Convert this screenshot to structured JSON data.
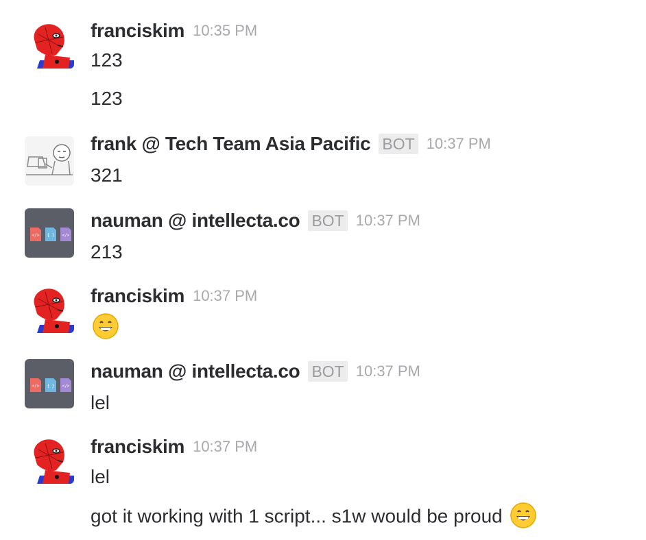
{
  "messages": [
    {
      "sender": "franciskim",
      "time": "10:35 PM",
      "lines": [
        "123",
        "123"
      ]
    },
    {
      "sender": "frank @ Tech Team Asia Pacific",
      "badge": "BOT",
      "time": "10:37 PM",
      "lines": [
        "321"
      ]
    },
    {
      "sender": "nauman @ intellecta.co",
      "badge": "BOT",
      "time": "10:37 PM",
      "lines": [
        "213"
      ]
    },
    {
      "sender": "franciskim",
      "time": "10:37 PM",
      "emoji": "grinning-face"
    },
    {
      "sender": "nauman @ intellecta.co",
      "badge": "BOT",
      "time": "10:37 PM",
      "lines": [
        "lel"
      ]
    },
    {
      "sender": "franciskim",
      "time": "10:37 PM",
      "lines": [
        "lel",
        "got it working with 1 script... s1w would be proud"
      ],
      "trailing_emoji": "grinning-face"
    }
  ],
  "colors": {
    "text": "#2c2d30",
    "time": "#a9a9ad",
    "badge_bg": "#ececec",
    "badge_text": "#9b9ba0",
    "bot_avatar_bg": "#5b5e66"
  },
  "icons": {
    "spiderman_avatar": "spiderman-avatar-icon",
    "frank_avatar": "meme-sketch-avatar-icon",
    "nauman_avatar": "code-files-avatar-icon",
    "emoji": "grinning-face-emoji-icon"
  }
}
